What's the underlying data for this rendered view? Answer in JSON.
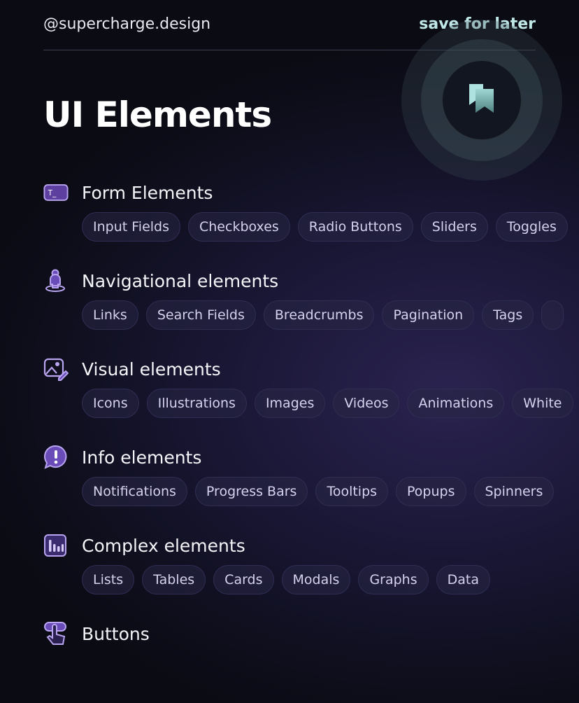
{
  "header": {
    "handle": "@supercharge.design",
    "save_label": "save for later"
  },
  "title": "UI Elements",
  "accent": "#7a5ccf",
  "sections": [
    {
      "icon": "terminal-icon",
      "title": "Form Elements",
      "chips": [
        "Input Fields",
        "Checkboxes",
        "Radio Buttons",
        "Sliders",
        "Toggles"
      ]
    },
    {
      "icon": "person-pin-icon",
      "title": "Navigational elements",
      "chips": [
        "Links",
        "Search Fields",
        "Breadcrumbs",
        "Pagination",
        "Tags",
        ""
      ]
    },
    {
      "icon": "image-edit-icon",
      "title": "Visual elements",
      "chips": [
        "Icons",
        "Illustrations",
        "Images",
        "Videos",
        "Animations",
        "White"
      ]
    },
    {
      "icon": "alert-bubble-icon",
      "title": "Info elements",
      "chips": [
        "Notifications",
        "Progress Bars",
        "Tooltips",
        "Popups",
        "Spinners"
      ]
    },
    {
      "icon": "bar-chart-icon",
      "title": "Complex elements",
      "chips": [
        "Lists",
        "Tables",
        "Cards",
        "Modals",
        "Graphs",
        "Data"
      ]
    },
    {
      "icon": "hand-tap-icon",
      "title": "Buttons",
      "chips": []
    }
  ]
}
